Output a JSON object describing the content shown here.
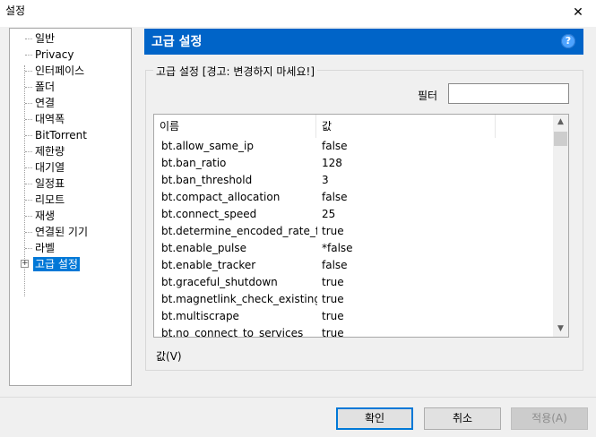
{
  "window": {
    "title": "설정",
    "close_glyph": "✕"
  },
  "tree": {
    "items": [
      {
        "label": "일반"
      },
      {
        "label": "Privacy"
      },
      {
        "label": "인터페이스"
      },
      {
        "label": "폴더"
      },
      {
        "label": "연결"
      },
      {
        "label": "대역폭"
      },
      {
        "label": "BitTorrent"
      },
      {
        "label": "제한량"
      },
      {
        "label": "대기열"
      },
      {
        "label": "일정표"
      },
      {
        "label": "리모트"
      },
      {
        "label": "재생"
      },
      {
        "label": "연결된 기기"
      },
      {
        "label": "라벨"
      },
      {
        "label": "고급 설정",
        "selected": true,
        "expander": "+"
      }
    ]
  },
  "header": {
    "title": "고급 설정",
    "help_glyph": "?"
  },
  "group": {
    "label": "고급 설정 [경고: 변경하지 마세요!]"
  },
  "filter": {
    "label": "필터",
    "value": ""
  },
  "list": {
    "columns": [
      "이름",
      "값"
    ],
    "rows": [
      {
        "name": "bt.allow_same_ip",
        "value": "false"
      },
      {
        "name": "bt.ban_ratio",
        "value": "128"
      },
      {
        "name": "bt.ban_threshold",
        "value": "3"
      },
      {
        "name": "bt.compact_allocation",
        "value": "false"
      },
      {
        "name": "bt.connect_speed",
        "value": "25"
      },
      {
        "name": "bt.determine_encoded_rate_fo...",
        "value": "true"
      },
      {
        "name": "bt.enable_pulse",
        "value": "*false"
      },
      {
        "name": "bt.enable_tracker",
        "value": "false"
      },
      {
        "name": "bt.graceful_shutdown",
        "value": "true"
      },
      {
        "name": "bt.magnetlink_check_existing_...",
        "value": "true"
      },
      {
        "name": "bt.multiscrape",
        "value": "true"
      },
      {
        "name": "bt.no_connect_to_services",
        "value": "true"
      }
    ],
    "scroll_up_glyph": "▲",
    "scroll_down_glyph": "▼"
  },
  "value_section": {
    "label": "값(V)"
  },
  "buttons": {
    "ok": "확인",
    "cancel": "취소",
    "apply": "적용(A)"
  }
}
